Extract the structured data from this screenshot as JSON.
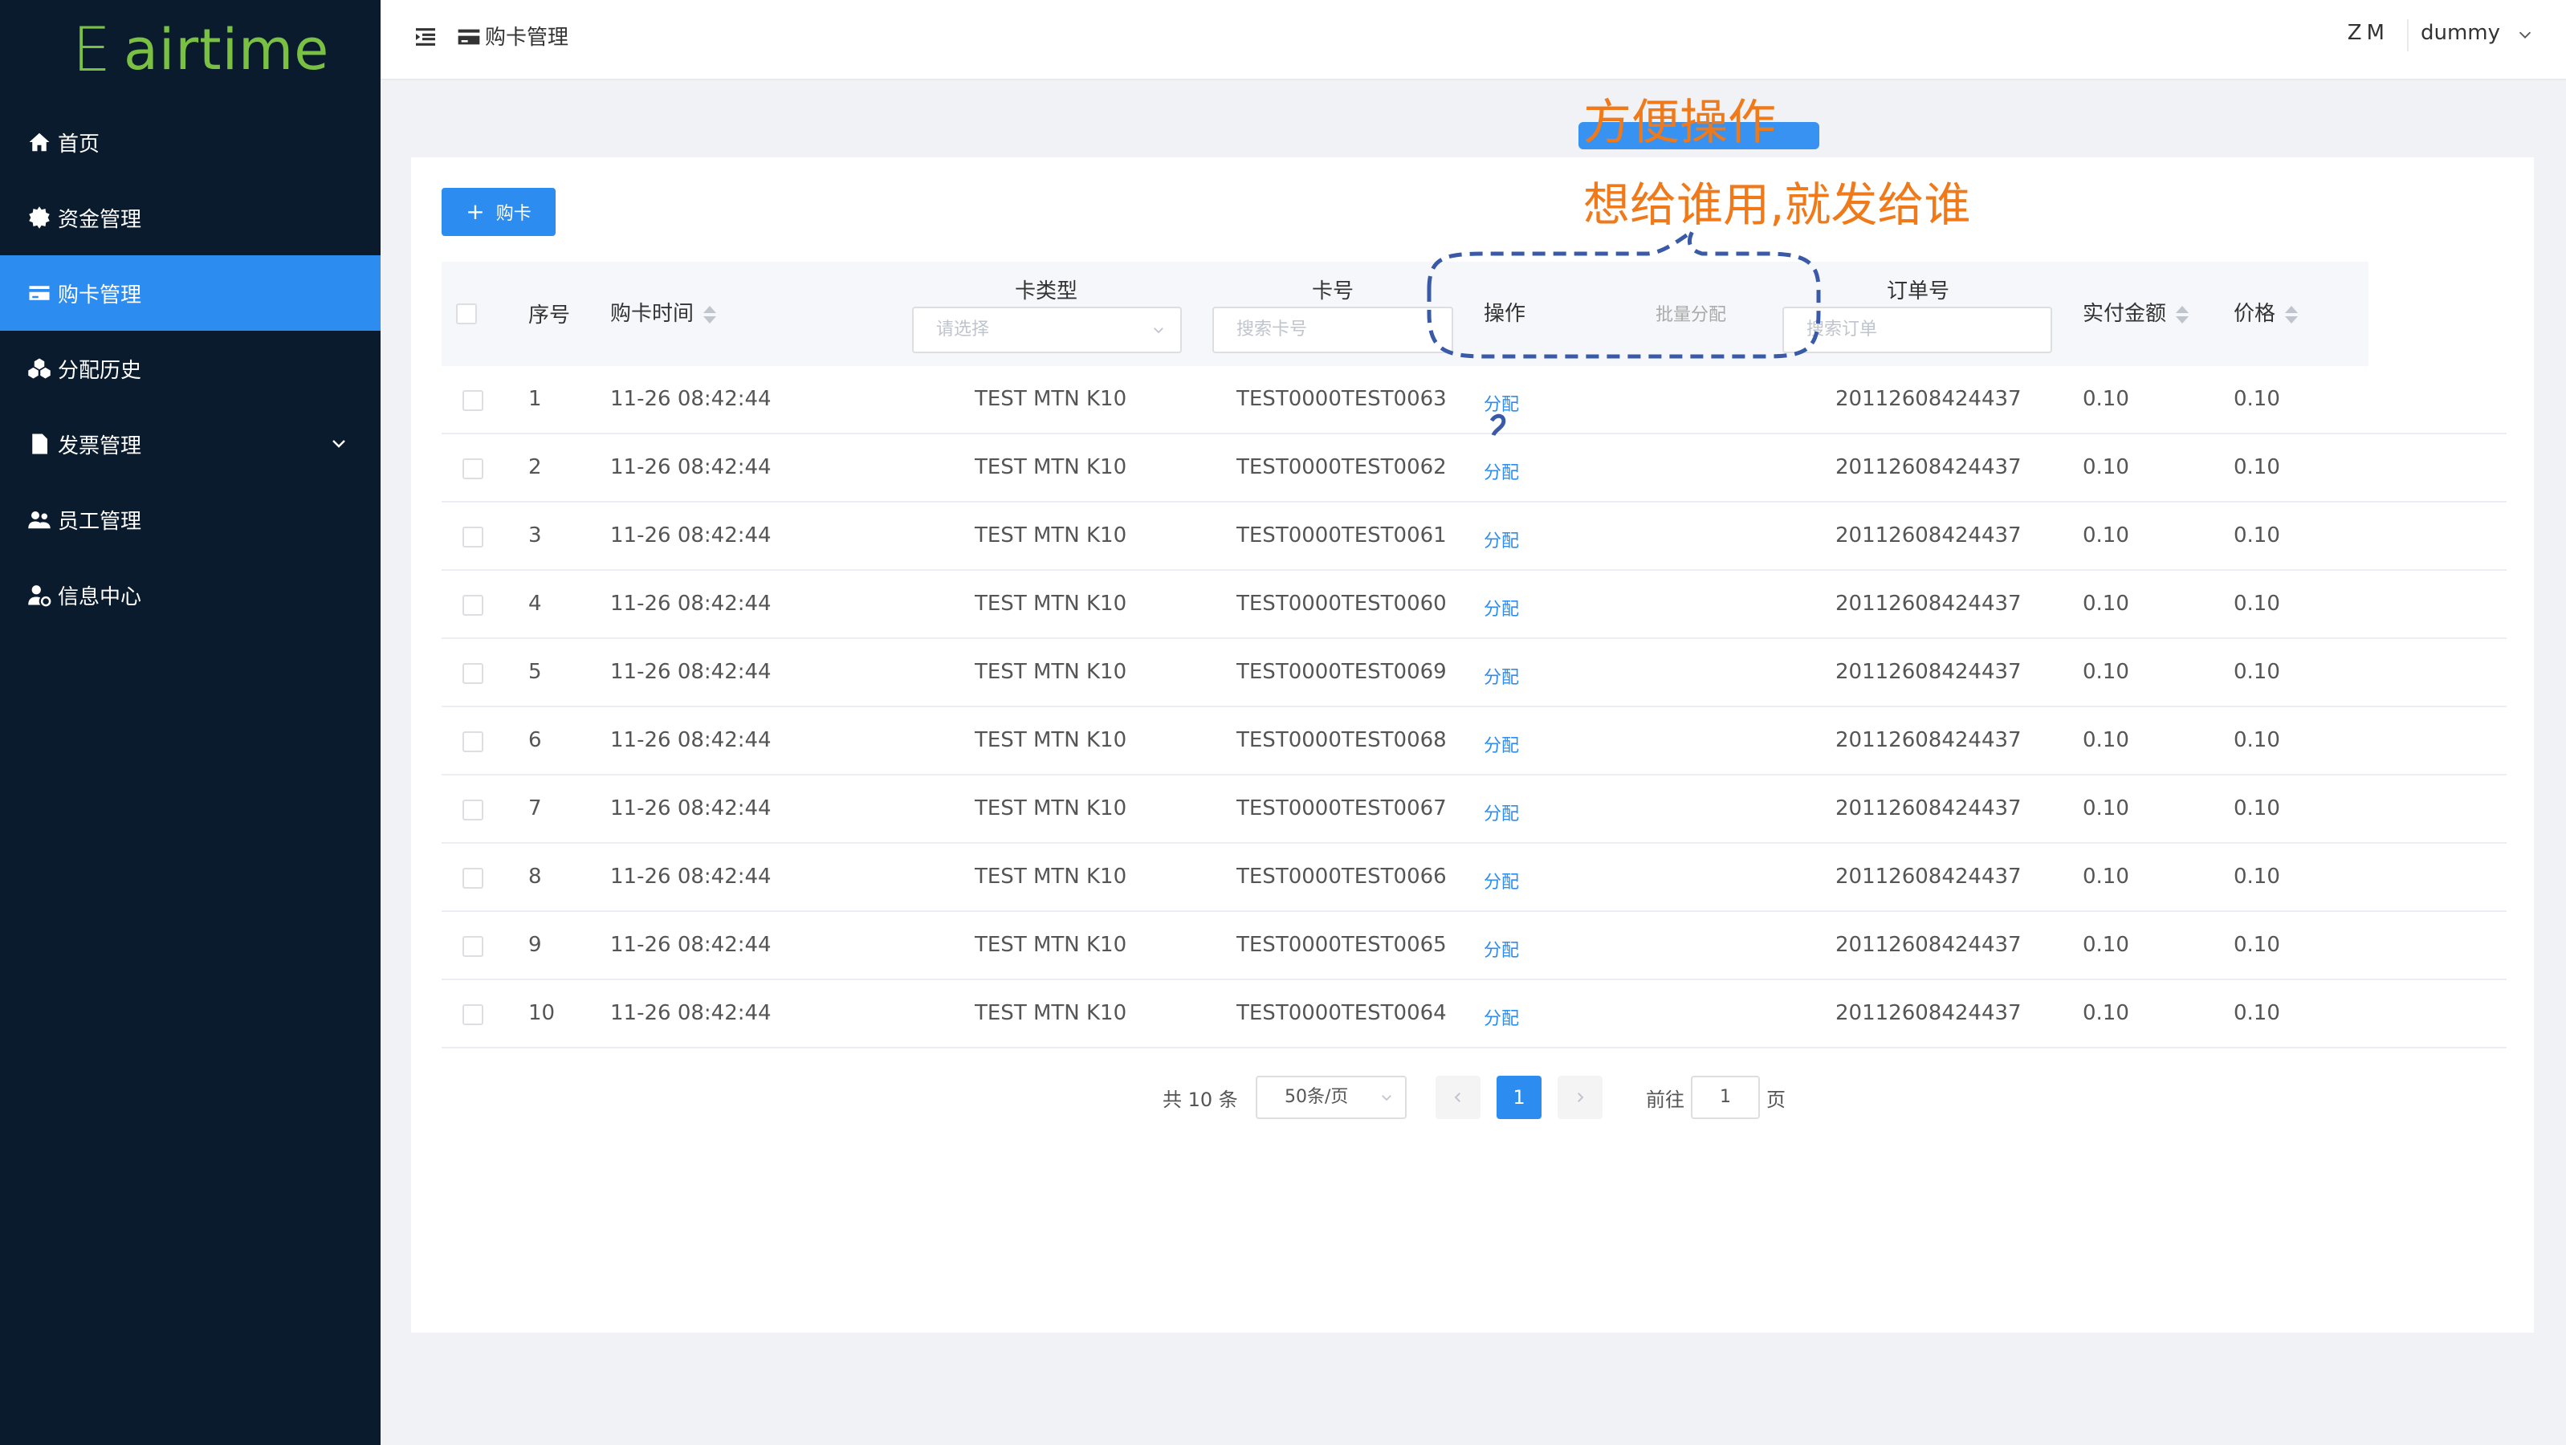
{
  "app": {
    "logo_letter": "E",
    "logo_text": "airtime",
    "brand_color": "#7ac143"
  },
  "sidebar": {
    "items": [
      {
        "label": "首页",
        "icon": "home-icon",
        "active": false
      },
      {
        "label": "资金管理",
        "icon": "gear-icon",
        "active": false
      },
      {
        "label": "购卡管理",
        "icon": "credit-card-icon",
        "active": true
      },
      {
        "label": "分配历史",
        "icon": "cubes-icon",
        "active": false
      },
      {
        "label": "发票管理",
        "icon": "file-icon",
        "active": false,
        "has_submenu": true
      },
      {
        "label": "员工管理",
        "icon": "users-icon",
        "active": false
      },
      {
        "label": "信息中心",
        "icon": "user-cog-icon",
        "active": false
      }
    ]
  },
  "header": {
    "breadcrumb": "购卡管理",
    "avatar_initials": "ZM",
    "username": "dummy"
  },
  "toolbar": {
    "buy_label": "购卡"
  },
  "table": {
    "columns": {
      "seq": "序号",
      "time": "购卡时间",
      "card_type": "卡类型",
      "card_no": "卡号",
      "action": "操作",
      "batch": "批量分配",
      "order_no": "订单号",
      "paid": "实付金额",
      "price": "价格"
    },
    "filters": {
      "card_type_placeholder": "请选择",
      "card_no_placeholder": "搜索卡号",
      "order_placeholder": "搜索订单"
    },
    "action_label": "分配",
    "rows": [
      {
        "seq": "1",
        "time": "11-26 08:42:44",
        "type": "TEST MTN K10",
        "card": "TEST0000TEST0063",
        "order": "20112608424437",
        "paid": "0.10",
        "price": "0.10"
      },
      {
        "seq": "2",
        "time": "11-26 08:42:44",
        "type": "TEST MTN K10",
        "card": "TEST0000TEST0062",
        "order": "20112608424437",
        "paid": "0.10",
        "price": "0.10"
      },
      {
        "seq": "3",
        "time": "11-26 08:42:44",
        "type": "TEST MTN K10",
        "card": "TEST0000TEST0061",
        "order": "20112608424437",
        "paid": "0.10",
        "price": "0.10"
      },
      {
        "seq": "4",
        "time": "11-26 08:42:44",
        "type": "TEST MTN K10",
        "card": "TEST0000TEST0060",
        "order": "20112608424437",
        "paid": "0.10",
        "price": "0.10"
      },
      {
        "seq": "5",
        "time": "11-26 08:42:44",
        "type": "TEST MTN K10",
        "card": "TEST0000TEST0069",
        "order": "20112608424437",
        "paid": "0.10",
        "price": "0.10"
      },
      {
        "seq": "6",
        "time": "11-26 08:42:44",
        "type": "TEST MTN K10",
        "card": "TEST0000TEST0068",
        "order": "20112608424437",
        "paid": "0.10",
        "price": "0.10"
      },
      {
        "seq": "7",
        "time": "11-26 08:42:44",
        "type": "TEST MTN K10",
        "card": "TEST0000TEST0067",
        "order": "20112608424437",
        "paid": "0.10",
        "price": "0.10"
      },
      {
        "seq": "8",
        "time": "11-26 08:42:44",
        "type": "TEST MTN K10",
        "card": "TEST0000TEST0066",
        "order": "20112608424437",
        "paid": "0.10",
        "price": "0.10"
      },
      {
        "seq": "9",
        "time": "11-26 08:42:44",
        "type": "TEST MTN K10",
        "card": "TEST0000TEST0065",
        "order": "20112608424437",
        "paid": "0.10",
        "price": "0.10"
      },
      {
        "seq": "10",
        "time": "11-26 08:42:44",
        "type": "TEST MTN K10",
        "card": "TEST0000TEST0064",
        "order": "20112608424437",
        "paid": "0.10",
        "price": "0.10"
      }
    ]
  },
  "pagination": {
    "total": "共 10 条",
    "page_size": "50条/页",
    "current_page": "1",
    "goto_label": "前往",
    "goto_value": "1",
    "goto_suffix": "页"
  },
  "annotation": {
    "title": "方便操作",
    "subtitle": "想给谁用,就发给谁",
    "color": "#f07a1a"
  }
}
